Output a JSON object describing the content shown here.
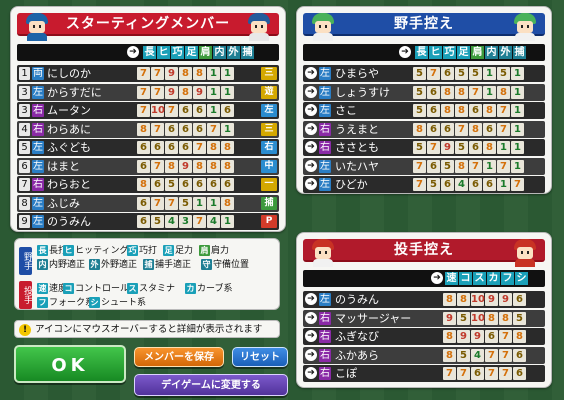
{
  "starting": {
    "title": "スターティングメンバー",
    "col_headers": [
      "長",
      "ヒ",
      "巧",
      "足",
      "肩",
      "内",
      "外",
      "捕"
    ],
    "players": [
      {
        "no": "1",
        "hand": "両",
        "name": "にしのか",
        "stats": [
          "7",
          "7",
          "9",
          "8",
          "8",
          "1",
          "1"
        ],
        "pos": "三",
        "pos_color": "#d4a800"
      },
      {
        "no": "3",
        "hand": "左",
        "name": "からすだに",
        "stats": [
          "7",
          "7",
          "9",
          "8",
          "9",
          "1",
          "1"
        ],
        "pos": "遊",
        "pos_color": "#d4a800"
      },
      {
        "no": "3",
        "hand": "右",
        "name": "ムータン",
        "stats": [
          "7",
          "10",
          "7",
          "6",
          "6",
          "1",
          "6"
        ],
        "pos": "左",
        "pos_color": "#2a8ccf"
      },
      {
        "no": "4",
        "hand": "右",
        "name": "わらあに",
        "stats": [
          "8",
          "7",
          "6",
          "6",
          "6",
          "7",
          "1"
        ],
        "pos": "三",
        "pos_color": "#d4a800"
      },
      {
        "no": "5",
        "hand": "左",
        "name": "ふぐども",
        "stats": [
          "6",
          "6",
          "6",
          "6",
          "7",
          "8",
          "8"
        ],
        "pos": "右",
        "pos_color": "#2a8ccf"
      },
      {
        "no": "6",
        "hand": "左",
        "name": "はまと",
        "stats": [
          "6",
          "7",
          "8",
          "9",
          "8",
          "8",
          "8"
        ],
        "pos": "中",
        "pos_color": "#2a8ccf"
      },
      {
        "no": "7",
        "hand": "右",
        "name": "わらおと",
        "stats": [
          "8",
          "6",
          "5",
          "6",
          "6",
          "6",
          "6"
        ],
        "pos": "一",
        "pos_color": "#d4a800"
      },
      {
        "no": "8",
        "hand": "左",
        "name": "ふじみ",
        "stats": [
          "6",
          "7",
          "7",
          "5",
          "1",
          "1",
          "8"
        ],
        "pos": "捕",
        "pos_color": "#3c9a3c"
      },
      {
        "no": "9",
        "hand": "左",
        "name": "のうみん",
        "stats": [
          "6",
          "5",
          "4",
          "3",
          "7",
          "4",
          "1"
        ],
        "pos": "P",
        "pos_color": "#d23b2a"
      }
    ]
  },
  "bench": {
    "title": "野手控え",
    "col_headers": [
      "長",
      "ヒ",
      "巧",
      "足",
      "肩",
      "内",
      "外",
      "捕"
    ],
    "players": [
      {
        "hand": "左",
        "name": "ひまらや",
        "stats": [
          "5",
          "7",
          "6",
          "5",
          "5",
          "1",
          "5",
          "1"
        ]
      },
      {
        "hand": "左",
        "name": "しょうすけ",
        "stats": [
          "5",
          "6",
          "8",
          "8",
          "7",
          "1",
          "8",
          "1"
        ]
      },
      {
        "hand": "左",
        "name": "さこ",
        "stats": [
          "5",
          "6",
          "8",
          "8",
          "6",
          "8",
          "7",
          "1"
        ]
      },
      {
        "hand": "右",
        "name": "うえまと",
        "stats": [
          "8",
          "6",
          "6",
          "7",
          "8",
          "6",
          "7",
          "1"
        ]
      },
      {
        "hand": "右",
        "name": "ささとも",
        "stats": [
          "5",
          "7",
          "9",
          "5",
          "6",
          "8",
          "1",
          "1"
        ]
      },
      {
        "hand": "左",
        "name": "いたハヤ",
        "stats": [
          "7",
          "6",
          "5",
          "8",
          "7",
          "1",
          "7",
          "1"
        ]
      },
      {
        "hand": "左",
        "name": "ひどか",
        "stats": [
          "7",
          "5",
          "6",
          "4",
          "6",
          "6",
          "1",
          "7"
        ]
      }
    ]
  },
  "pitchers": {
    "title": "投手控え",
    "col_headers": [
      "速",
      "コ",
      "ス",
      "カ",
      "フ",
      "シ"
    ],
    "players": [
      {
        "hand": "左",
        "name": "のうみん",
        "stats": [
          "8",
          "8",
          "10",
          "9",
          "9",
          "6"
        ]
      },
      {
        "hand": "右",
        "name": "マッサージャー",
        "stats": [
          "9",
          "5",
          "10",
          "8",
          "8",
          "5"
        ]
      },
      {
        "hand": "右",
        "name": "ふぎなび",
        "stats": [
          "8",
          "9",
          "9",
          "6",
          "7",
          "8"
        ]
      },
      {
        "hand": "右",
        "name": "ふかあら",
        "stats": [
          "8",
          "5",
          "4",
          "7",
          "7",
          "6"
        ]
      },
      {
        "hand": "右",
        "name": "こぽ",
        "stats": [
          "7",
          "7",
          "6",
          "7",
          "7",
          "6"
        ]
      }
    ]
  },
  "legend": {
    "batter_tag": "野手",
    "pitcher_tag": "投手",
    "batter_items": [
      {
        "icon": "長",
        "label": "長打",
        "color": "#1aa0b8"
      },
      {
        "icon": "ヒ",
        "label": "ヒッティング",
        "color": "#1aa0b8"
      },
      {
        "icon": "巧",
        "label": "巧打",
        "color": "#1aa0b8"
      },
      {
        "icon": "足",
        "label": "足力",
        "color": "#1aa0b8"
      },
      {
        "icon": "肩",
        "label": "肩力",
        "color": "#3c9a3c"
      },
      {
        "icon": "内",
        "label": "内野適正",
        "color": "#1f7f94"
      },
      {
        "icon": "外",
        "label": "外野適正",
        "color": "#1f7f94"
      },
      {
        "icon": "捕",
        "label": "捕手適正",
        "color": "#1f7f94"
      },
      {
        "icon": "守",
        "label": "守備位置",
        "color": "#1f7f94"
      }
    ],
    "pitcher_items": [
      {
        "icon": "速",
        "label": "速度",
        "color": "#1aa0b8"
      },
      {
        "icon": "コ",
        "label": "コントロール",
        "color": "#1aa0b8"
      },
      {
        "icon": "ス",
        "label": "スタミナ",
        "color": "#1aa0b8"
      },
      {
        "icon": "カ",
        "label": "カーブ系",
        "color": "#1aa0b8"
      },
      {
        "icon": "フ",
        "label": "フォーク系",
        "color": "#1aa0b8"
      },
      {
        "icon": "シ",
        "label": "シュート系",
        "color": "#1aa0b8"
      }
    ]
  },
  "hint": {
    "icon": "!",
    "text": "アイコンにマウスオーバーすると詳細が表示されます"
  },
  "buttons": {
    "ok": "OK",
    "save": "メンバーを保存",
    "reset": "リセット",
    "day": "デイゲームに変更する"
  },
  "colors": {
    "red": "#c81b2e",
    "blue": "#1f4ea6",
    "right_hand": "#8a2aa6",
    "left_hand": "#2a7dc4",
    "high": "#c0392b",
    "mid": "#d4700a",
    "low": "#1a7a2a"
  }
}
